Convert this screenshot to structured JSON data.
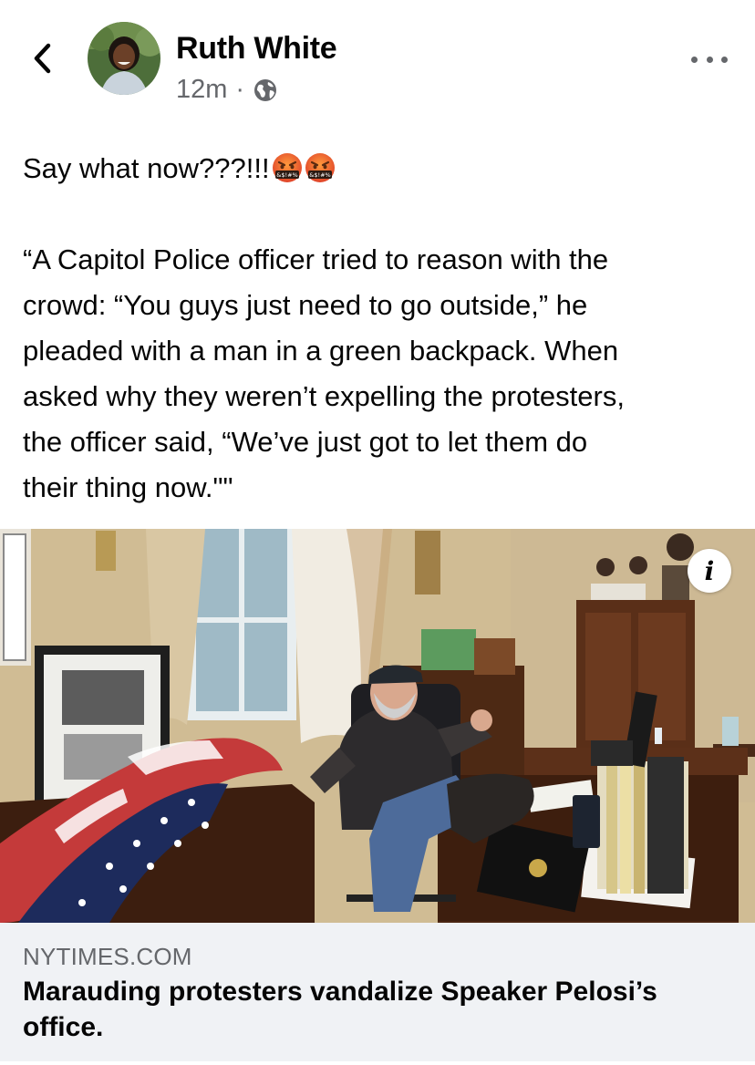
{
  "header": {
    "author_name": "Ruth White",
    "timestamp": "12m",
    "separator": "·",
    "privacy_icon": "globe-icon",
    "back_icon": "chevron-left-icon",
    "more_icon": "more-horizontal-icon"
  },
  "post": {
    "lines": [
      "Say what now???!!!",
      "“A Capitol Police officer tried to reason with the",
      "crowd: “You guys just need to go outside,” he",
      "pleaded with a man in a green backpack. When",
      "asked why they weren’t expelling the protesters,",
      "the officer said, “We’ve just got to let them do",
      "their thing now.\"\""
    ],
    "emoji_name": "face-with-symbols-on-mouth",
    "emoji_text": "&$!#%"
  },
  "link": {
    "domain": "NYTIMES.COM",
    "title": "Marauding protesters vandalize Speaker Pelosi’s office.",
    "info_label": "i",
    "image_description_icon": "article-photo"
  },
  "colors": {
    "text": "#050505",
    "secondary": "#65676b",
    "card_bg": "#f0f2f5"
  }
}
